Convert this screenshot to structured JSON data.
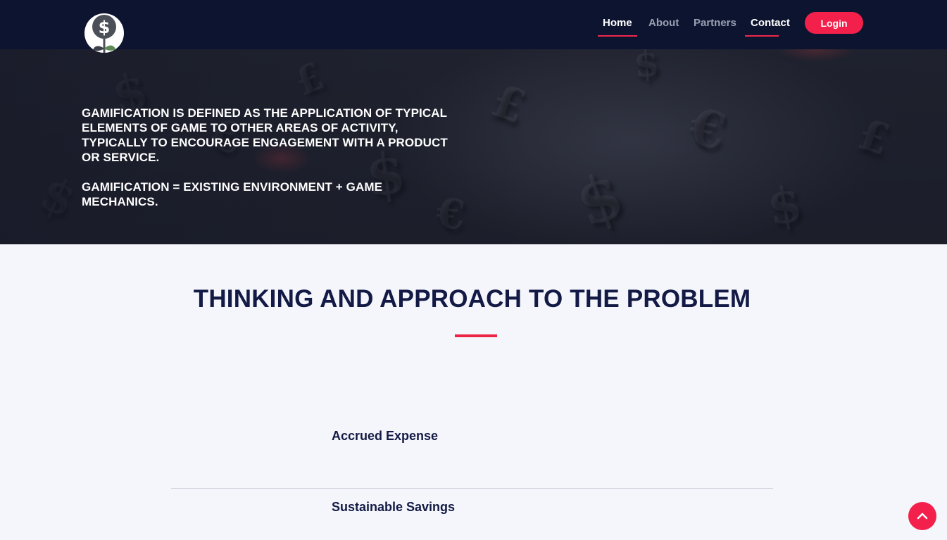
{
  "colors": {
    "navbar_bg": "#0d1430",
    "accent": "#f2204a",
    "heading": "#131a45",
    "page_bg": "#f5f6fb"
  },
  "header": {
    "logo_icon": "dollar-plant-logo",
    "nav": [
      {
        "label": "Home",
        "active": true
      },
      {
        "label": "About",
        "active": false
      },
      {
        "label": "Partners",
        "active": false
      },
      {
        "label": "Contact",
        "active": true
      }
    ],
    "login_label": "Login"
  },
  "hero": {
    "line1": "GAMIFICATION IS DEFINED AS THE APPLICATION OF TYPICAL ELEMENTS OF GAME TO OTHER AREAS OF ACTIVITY, TYPICALLY TO ENCOURAGE ENGAGEMENT WITH A PRODUCT OR SERVICE.",
    "line2": "GAMIFICATION = EXISTING ENVIRONMENT + GAME MECHANICS."
  },
  "section": {
    "title": "THINKING AND APPROACH TO THE PROBLEM",
    "items": [
      {
        "label": "Accrued Expense"
      },
      {
        "label": "Sustainable Savings"
      }
    ]
  },
  "scroll_top_icon": "chevron-up-icon"
}
